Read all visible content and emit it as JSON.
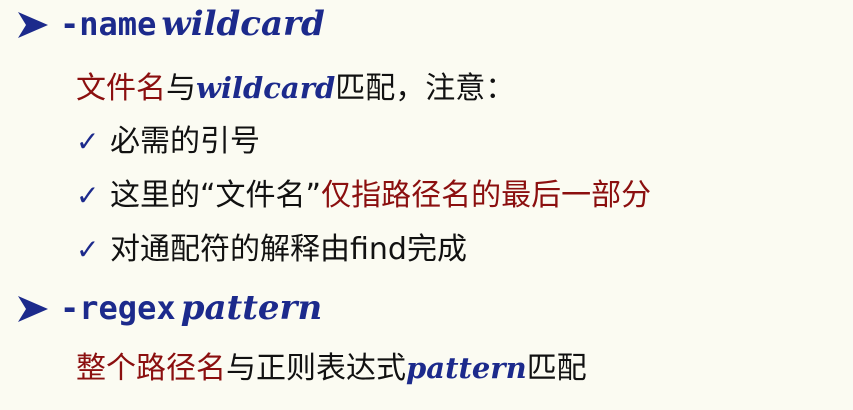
{
  "items": [
    {
      "option": "-name",
      "argument": "wildcard",
      "description": {
        "part1": "文件名",
        "part2": "与",
        "arg": "wildcard",
        "part3": "匹配，注意："
      },
      "notes": [
        {
          "text": "必需的引号"
        },
        {
          "text_a": "这里的“文件名”",
          "text_b": "仅指路径名的最后一部分"
        },
        {
          "text": "对通配符的解释由find完成"
        }
      ]
    },
    {
      "option": "-regex",
      "argument": "pattern",
      "description": {
        "part1": "整个路径名",
        "part2": "与正则表达式",
        "arg": "pattern",
        "part3": "匹配"
      }
    }
  ],
  "check_glyph": "✓",
  "colors": {
    "blue": "#1c2a8c",
    "red": "#8b0f0f",
    "background": "#fbfbf2"
  }
}
